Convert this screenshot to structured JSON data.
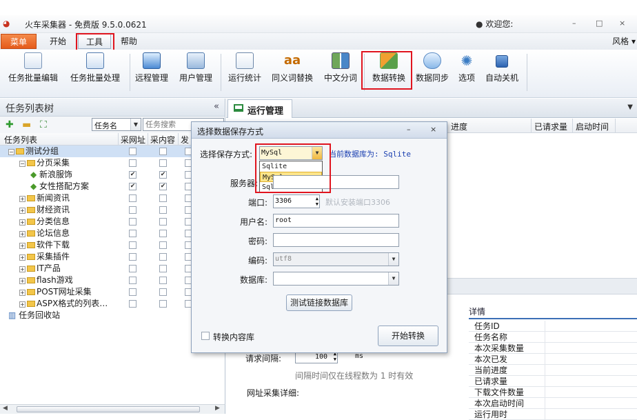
{
  "app": {
    "title": "火车采集器 - 免费版 9.5.0.0621",
    "welcome": "欢迎您:",
    "window_controls": [
      "–",
      "□",
      "×"
    ]
  },
  "menubar": {
    "tabs": [
      "菜单",
      "开始",
      "工具",
      "帮助"
    ],
    "style": "风格 ▾"
  },
  "ribbon": {
    "buttons": [
      "任务批量编辑",
      "任务批量处理",
      "远程管理",
      "用户管理",
      "运行统计",
      "同义词替换",
      "中文分词",
      "数据转换",
      "数据同步",
      "选项",
      "自动关机"
    ]
  },
  "left_panel": {
    "title": "任务列表树",
    "collapse": "«",
    "search_type": "任务名",
    "search_placeholder": "任务搜索",
    "columns": [
      "任务列表",
      "采网址",
      "采内容",
      "发"
    ],
    "tree": [
      {
        "label": "测试分组",
        "level": 0,
        "expander": "⊟",
        "folder": true,
        "selected": true,
        "checks": [
          false,
          false,
          false
        ]
      },
      {
        "label": "分页采集",
        "level": 1,
        "expander": "⊟",
        "folder": true,
        "selected": false,
        "checks": [
          false,
          false,
          false
        ]
      },
      {
        "label": "新浪服饰",
        "level": 2,
        "expander": "",
        "folder": false,
        "selected": false,
        "checks": [
          true,
          true,
          false
        ]
      },
      {
        "label": "女性搭配方案",
        "level": 2,
        "expander": "",
        "folder": false,
        "selected": false,
        "checks": [
          true,
          true,
          false
        ]
      },
      {
        "label": "新闻资讯",
        "level": 1,
        "expander": "⊞",
        "folder": true,
        "selected": false,
        "checks": [
          false,
          false,
          false
        ]
      },
      {
        "label": "财经资讯",
        "level": 1,
        "expander": "⊞",
        "folder": true,
        "selected": false,
        "checks": [
          false,
          false,
          false
        ]
      },
      {
        "label": "分类信息",
        "level": 1,
        "expander": "⊞",
        "folder": true,
        "selected": false,
        "checks": [
          false,
          false,
          false
        ]
      },
      {
        "label": "论坛信息",
        "level": 1,
        "expander": "⊞",
        "folder": true,
        "selected": false,
        "checks": [
          false,
          false,
          false
        ]
      },
      {
        "label": "软件下载",
        "level": 1,
        "expander": "⊞",
        "folder": true,
        "selected": false,
        "checks": [
          false,
          false,
          false
        ]
      },
      {
        "label": "采集插件",
        "level": 1,
        "expander": "⊞",
        "folder": true,
        "selected": false,
        "checks": [
          false,
          false,
          false
        ]
      },
      {
        "label": "IT产品",
        "level": 1,
        "expander": "⊞",
        "folder": true,
        "selected": false,
        "checks": [
          false,
          false,
          false
        ]
      },
      {
        "label": "flash游戏",
        "level": 1,
        "expander": "⊞",
        "folder": true,
        "selected": false,
        "checks": [
          false,
          false,
          false
        ]
      },
      {
        "label": "POST网址采集",
        "level": 1,
        "expander": "⊞",
        "folder": true,
        "selected": false,
        "checks": [
          false,
          false,
          false
        ]
      },
      {
        "label": "ASPX格式的列表…",
        "level": 1,
        "expander": "⊞",
        "folder": true,
        "selected": false,
        "checks": [
          false,
          false,
          false
        ]
      },
      {
        "label": "任务回收站",
        "level": 0,
        "expander": "",
        "folder": false,
        "selected": false,
        "checks": null
      }
    ]
  },
  "right": {
    "tab": "运行管理",
    "grid_columns": [
      "进度",
      "已请求量",
      "启动时间"
    ],
    "request_interval_label": "请求间隔:",
    "request_interval_value": "100",
    "request_interval_unit": "ms",
    "interval_hint": "间隔时间仅在线程数为 1 时有效",
    "url_detail_label": "网址采集详细:",
    "details_title": "详情",
    "details": [
      "任务ID",
      "任务名称",
      "本次采集数量",
      "本次已发",
      "当前进度",
      "已请求量",
      "下载文件数量",
      "本次启动时间",
      "运行用时"
    ]
  },
  "dialog": {
    "title": "选择数据保存方式",
    "save_mode_label": "选择保存方式:",
    "save_mode_value": "MySql",
    "current_db": "当前数据库为: Sqlite",
    "dropdown_options": [
      "Sqlite",
      "MySql",
      "SqlServer"
    ],
    "dropdown_selected": 1,
    "server_label": "服务器:",
    "port_label": "端口:",
    "port_value": "3306",
    "port_hint": "默认安装端口3306",
    "username_label": "用户名:",
    "username_value": "root",
    "password_label": "密码:",
    "encoding_label": "编码:",
    "encoding_value": "utf8",
    "database_label": "数据库:",
    "test_button": "测试链接数据库",
    "convert_content_label": "转换内容库",
    "start_button": "开始转换",
    "minimize": "–",
    "close": "×"
  }
}
